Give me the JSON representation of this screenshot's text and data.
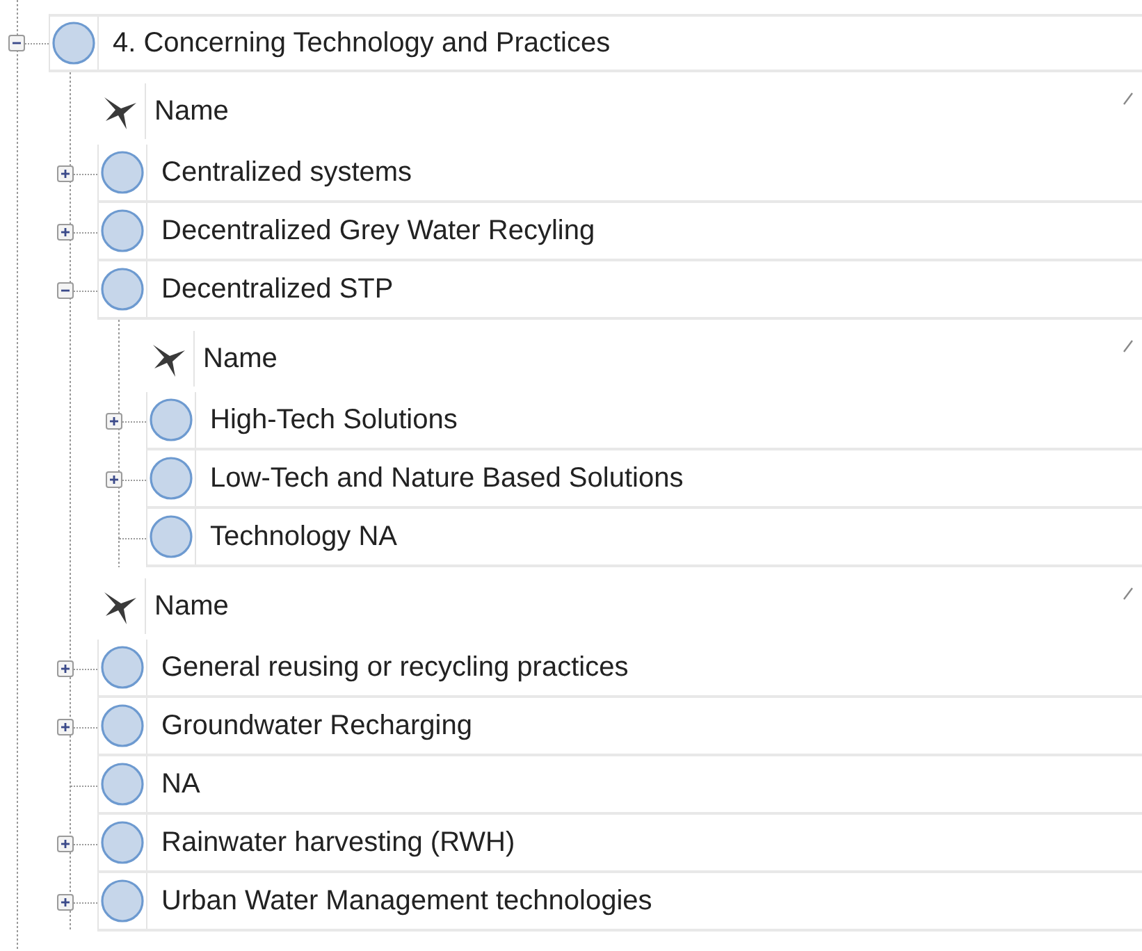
{
  "root": {
    "kind": "node",
    "label": "4. Concerning Technology and Practices",
    "has_children": true,
    "expanded": true,
    "children": [
      {
        "kind": "header",
        "label": "Name"
      },
      {
        "kind": "node",
        "label": "Centralized systems",
        "has_children": true,
        "expanded": false
      },
      {
        "kind": "node",
        "label": "Decentralized Grey Water Recyling",
        "has_children": true,
        "expanded": false
      },
      {
        "kind": "node",
        "label": "Decentralized STP",
        "has_children": true,
        "expanded": true,
        "children": [
          {
            "kind": "header",
            "label": "Name"
          },
          {
            "kind": "node",
            "label": "High-Tech Solutions",
            "has_children": true,
            "expanded": false
          },
          {
            "kind": "node",
            "label": "Low-Tech and Nature Based Solutions",
            "has_children": true,
            "expanded": false
          },
          {
            "kind": "leaf",
            "label": "Technology NA"
          }
        ]
      },
      {
        "kind": "header",
        "label": "Name"
      },
      {
        "kind": "node",
        "label": "General reusing or recycling practices",
        "has_children": true,
        "expanded": false
      },
      {
        "kind": "node",
        "label": "Groundwater Recharging",
        "has_children": true,
        "expanded": false
      },
      {
        "kind": "leaf",
        "label": "NA"
      },
      {
        "kind": "node",
        "label": "Rainwater harvesting (RWH)",
        "has_children": true,
        "expanded": false
      },
      {
        "kind": "node",
        "label": "Urban Water Management technologies",
        "has_children": true,
        "expanded": false
      }
    ]
  }
}
